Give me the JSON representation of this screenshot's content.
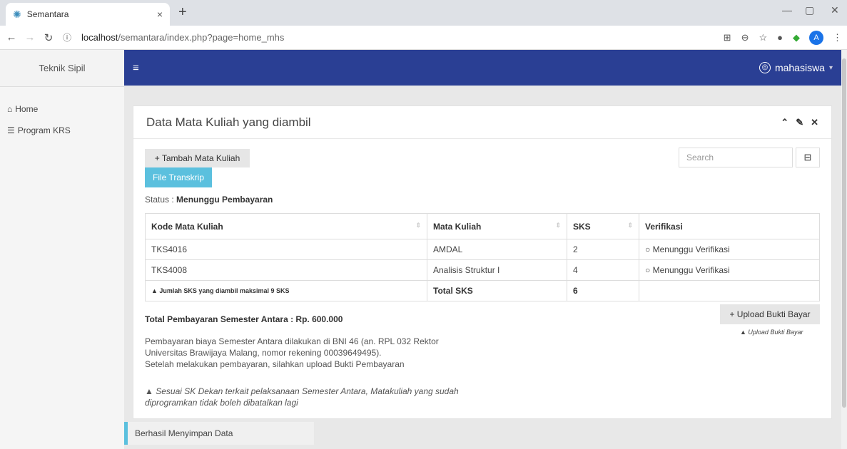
{
  "browser": {
    "tab_title": "Semantara",
    "tab_close": "×",
    "new_tab": "+",
    "url_host": "localhost",
    "url_path": "/semantara/index.php?page=home_mhs",
    "profile_initial": "A",
    "controls": {
      "minimize": "—",
      "maximize": "▢",
      "close": "✕"
    }
  },
  "sidebar": {
    "brand": "Teknik Sipil",
    "items": [
      {
        "label": "Home",
        "icon": "home-icon"
      },
      {
        "label": "Program KRS",
        "icon": "list-icon"
      }
    ]
  },
  "topbar": {
    "menu_icon": "≡",
    "user": "mahasiswa"
  },
  "panel": {
    "title": "Data Mata Kuliah yang diambil",
    "add_button": "+ Tambah Mata Kuliah",
    "file_button": "File Transkrip",
    "status_label": "Status : ",
    "status_value": "Menunggu Pembayaran",
    "search_placeholder": "Search",
    "table": {
      "headers": [
        "Kode Mata Kuliah",
        "Mata Kuliah",
        "SKS",
        "Verifikasi"
      ],
      "rows": [
        {
          "kode": "TKS4016",
          "nama": "AMDAL",
          "sks": "2",
          "verifikasi": "Menunggu Verifikasi"
        },
        {
          "kode": "TKS4008",
          "nama": "Analisis Struktur I",
          "sks": "4",
          "verifikasi": "Menunggu Verifikasi"
        }
      ],
      "footer_note": "Jumlah SKS yang diambil maksimal 9 SKS",
      "footer_label": "Total SKS",
      "footer_total": "6"
    },
    "upload_button": "+ Upload Bukti Bayar",
    "upload_note": "Upload Bukti Bayar",
    "total_payment": "Total Pembayaran Semester Antara : Rp. 600.000",
    "info_lines": [
      "Pembayaran biaya Semester Antara dilakukan di BNI 46 (an. RPL 032 Rektor",
      "Universitas Brawijaya Malang, nomor rekening 00039649495).",
      "Setelah melakukan pembayaran, silahkan upload Bukti Pembayaran"
    ],
    "warning_lines": [
      "Sesuai SK Dekan terkait pelaksanaan Semester Antara, Matakuliah yang sudah",
      "diprogramkan tidak boleh dibatalkan lagi"
    ]
  },
  "toast": "Berhasil Menyimpan Data"
}
